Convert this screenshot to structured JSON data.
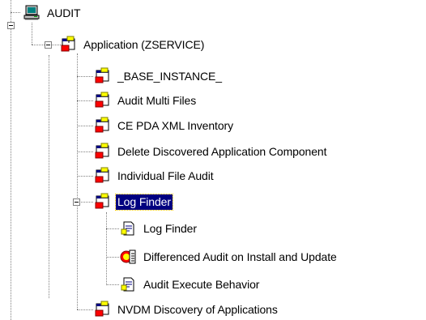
{
  "tree": {
    "root": {
      "label": "AUDIT",
      "icon": "computer-icon"
    },
    "application": {
      "label": "Application (ZSERVICE)",
      "icon": "application-package-icon"
    },
    "items": [
      {
        "label": "_BASE_INSTANCE_",
        "icon": "application-package-icon"
      },
      {
        "label": "Audit Multi Files",
        "icon": "application-package-icon"
      },
      {
        "label": "CE PDA XML Inventory",
        "icon": "application-package-icon"
      },
      {
        "label": "Delete Discovered Application Component",
        "icon": "application-package-icon"
      },
      {
        "label": "Individual File Audit",
        "icon": "application-package-icon"
      }
    ],
    "selected": {
      "label": "Log Finder",
      "icon": "application-package-icon"
    },
    "children": [
      {
        "label": "Log Finder",
        "icon": "document-script-icon"
      },
      {
        "label": "Differenced Audit on Install and Update",
        "icon": "audit-document-icon"
      },
      {
        "label": "Audit Execute Behavior",
        "icon": "document-script-icon"
      }
    ],
    "last": {
      "label": "NVDM Discovery of Applications",
      "icon": "application-package-icon"
    }
  },
  "colors": {
    "selection_bg": "#000080",
    "selection_text": "#ffffff",
    "tree_line": "#808080"
  }
}
